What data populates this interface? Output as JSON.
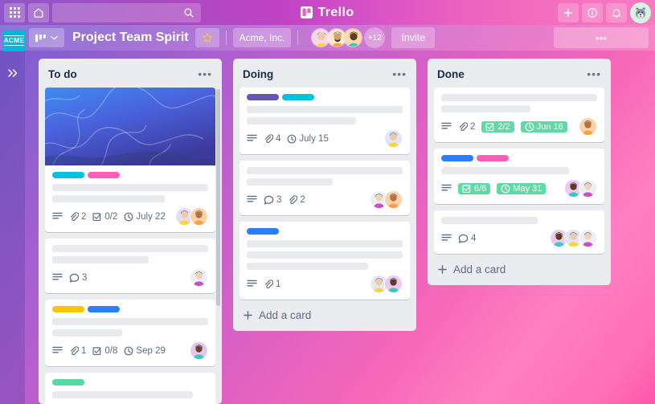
{
  "topbar": {
    "brand": "Trello",
    "brand_logo_icon": "trello-logo-icon",
    "apps_icon": "apps-grid-icon",
    "home_icon": "home-icon",
    "search_icon": "search-icon",
    "search_placeholder": "",
    "search_value": "",
    "add_icon": "plus-icon",
    "info_icon": "info-icon",
    "notifications_icon": "bell-icon",
    "avatar_icon": "user-avatar-dog-icon"
  },
  "board_header": {
    "workspace_logo_text": "ACME",
    "view_switcher_icon": "board-view-icon",
    "view_switcher_caret": "chevron-down-icon",
    "title": "Project Team Spirit",
    "star_icon": "star-icon",
    "workspace_name": "Acme, Inc.",
    "extra_members": "+12",
    "invite_label": "Invite",
    "menu_label": "•••",
    "members": [
      {
        "name": "member-1",
        "skin": "#f0c9a8",
        "hair": "#2e3a59",
        "shirt": "#ffd43b",
        "bg": "#f5d9e6"
      },
      {
        "name": "member-2",
        "skin": "#d8a06a",
        "hair": "#2b2b2b",
        "shirt": "#ff9f43",
        "bg": "#fde8c8"
      },
      {
        "name": "member-3",
        "skin": "#5d3a22",
        "hair": "#1a1a1a",
        "shirt": "#3ec9c0",
        "bg": "#ffd9a8"
      }
    ]
  },
  "sidebar": {
    "expand_icon": "double-chevron-right-icon"
  },
  "lists": [
    {
      "title": "To do",
      "menu_icon": "list-menu-dots-icon",
      "add_card_label": "",
      "has_add_card": false,
      "cards": [
        {
          "has_cover": true,
          "labels": [
            "#00c2e0",
            "#ff5eb8"
          ],
          "lines": [
            100,
            72
          ],
          "badges": [
            {
              "type": "description",
              "icon": "description-icon"
            },
            {
              "type": "attachment",
              "icon": "attachment-icon",
              "text": "2"
            },
            {
              "type": "checklist",
              "icon": "checklist-icon",
              "text": "0/2"
            },
            {
              "type": "due",
              "icon": "clock-icon",
              "text": "July 22"
            }
          ],
          "avatars": [
            {
              "name": "avatar-a",
              "skin": "#f0c9a8",
              "hair": "#2e3a59",
              "shirt": "#ffd43b",
              "bg": "#e7dcf5"
            },
            {
              "name": "avatar-b",
              "skin": "#b5713f",
              "hair": "#1a1a1a",
              "shirt": "#ff9f43",
              "bg": "#ffd2a8"
            }
          ]
        },
        {
          "has_cover": false,
          "labels": [],
          "lines": [
            100,
            62
          ],
          "badges": [
            {
              "type": "description",
              "icon": "description-icon"
            },
            {
              "type": "comment",
              "icon": "comment-icon",
              "text": "3"
            }
          ],
          "avatars": [
            {
              "name": "avatar-c",
              "skin": "#f2d2bd",
              "hair": "#232c4a",
              "shirt": "#cc4fc4",
              "bg": "#eceff4"
            }
          ]
        },
        {
          "has_cover": false,
          "labels": [
            "#ffc400",
            "#2a7fff"
          ],
          "lines": [
            100,
            45
          ],
          "badges": [
            {
              "type": "description",
              "icon": "description-icon"
            },
            {
              "type": "attachment",
              "icon": "attachment-icon",
              "text": "1"
            },
            {
              "type": "checklist",
              "icon": "checklist-icon",
              "text": "0/8"
            },
            {
              "type": "due",
              "icon": "clock-icon",
              "text": "Sep 29"
            }
          ],
          "avatars": [
            {
              "name": "avatar-d",
              "skin": "#6b4226",
              "hair": "#181818",
              "shirt": "#3ec9c0",
              "bg": "#e6c6ee"
            }
          ]
        },
        {
          "has_cover": false,
          "labels": [
            "#57d9a3"
          ],
          "lines": [
            90
          ],
          "badges": [],
          "avatars": []
        }
      ]
    },
    {
      "title": "Doing",
      "menu_icon": "list-menu-dots-icon",
      "add_card_label": "Add a card",
      "has_add_card": true,
      "cards": [
        {
          "has_cover": false,
          "labels": [
            "#6555b5",
            "#00c2e0"
          ],
          "lines": [
            100,
            70
          ],
          "badges": [
            {
              "type": "description",
              "icon": "description-icon"
            },
            {
              "type": "attachment",
              "icon": "attachment-icon",
              "text": "4"
            },
            {
              "type": "due",
              "icon": "clock-icon",
              "text": "July 15"
            }
          ],
          "avatars": [
            {
              "name": "avatar-e",
              "skin": "#f0c9a8",
              "hair": "#2e3a59",
              "shirt": "#ffd43b",
              "bg": "#dfe6f5"
            }
          ]
        },
        {
          "has_cover": false,
          "labels": [],
          "lines": [
            100,
            55
          ],
          "badges": [
            {
              "type": "description",
              "icon": "description-icon"
            },
            {
              "type": "comment",
              "icon": "comment-icon",
              "text": "3"
            },
            {
              "type": "attachment",
              "icon": "attachment-icon",
              "text": "2"
            }
          ],
          "avatars": [
            {
              "name": "avatar-f",
              "skin": "#f2d2bd",
              "hair": "#232c4a",
              "shirt": "#cc4fc4",
              "bg": "#eceff4"
            },
            {
              "name": "avatar-g",
              "skin": "#b5713f",
              "hair": "#1a1a1a",
              "shirt": "#ff9f43",
              "bg": "#ffd2a8"
            }
          ]
        },
        {
          "has_cover": false,
          "labels": [
            "#2a7fff"
          ],
          "lines": [
            100,
            100,
            78
          ],
          "badges": [
            {
              "type": "description",
              "icon": "description-icon"
            },
            {
              "type": "attachment",
              "icon": "attachment-icon",
              "text": "1"
            }
          ],
          "avatars": [
            {
              "name": "avatar-h",
              "skin": "#f0c9a8",
              "hair": "#2e3a59",
              "shirt": "#ffd43b",
              "bg": "#e4e9f7"
            },
            {
              "name": "avatar-i",
              "skin": "#5d3a22",
              "hair": "#161616",
              "shirt": "#3ec9c0",
              "bg": "#edc9ef"
            }
          ]
        }
      ]
    },
    {
      "title": "Done",
      "menu_icon": "list-menu-dots-icon",
      "add_card_label": "Add a card",
      "has_add_card": true,
      "cards": [
        {
          "has_cover": false,
          "labels": [],
          "lines": [
            100,
            57
          ],
          "badges": [
            {
              "type": "description",
              "icon": "description-icon"
            },
            {
              "type": "attachment",
              "icon": "attachment-icon",
              "text": "2"
            },
            {
              "type": "checklist-done",
              "icon": "checklist-icon",
              "text": "2/2"
            },
            {
              "type": "due-done",
              "icon": "clock-icon",
              "text": "Jun 16"
            }
          ],
          "avatars": [
            {
              "name": "avatar-j",
              "skin": "#b5713f",
              "hair": "#1a1a1a",
              "shirt": "#ff9f43",
              "bg": "#ffd2a8"
            }
          ]
        },
        {
          "has_cover": false,
          "labels": [
            "#2a7fff",
            "#ff5eb8"
          ],
          "lines": [
            82
          ],
          "badges": [
            {
              "type": "description",
              "icon": "description-icon"
            },
            {
              "type": "checklist-done",
              "icon": "checklist-icon",
              "text": "6/6"
            },
            {
              "type": "due-done",
              "icon": "clock-icon",
              "text": "May 31"
            }
          ],
          "avatars": [
            {
              "name": "avatar-k",
              "skin": "#5d3a22",
              "hair": "#161616",
              "shirt": "#3ec9c0",
              "bg": "#edc9ef"
            },
            {
              "name": "avatar-l",
              "skin": "#f2d2bd",
              "hair": "#232c4a",
              "shirt": "#cc4fc4",
              "bg": "#eceff4"
            }
          ]
        },
        {
          "has_cover": false,
          "labels": [],
          "lines": [
            62
          ],
          "badges": [
            {
              "type": "description",
              "icon": "description-icon"
            },
            {
              "type": "comment",
              "icon": "comment-icon",
              "text": "4"
            }
          ],
          "avatars": [
            {
              "name": "avatar-m",
              "skin": "#5d3a22",
              "hair": "#161616",
              "shirt": "#3ec9c0",
              "bg": "#edc9ef"
            },
            {
              "name": "avatar-n",
              "skin": "#f0c9a8",
              "hair": "#2e3a59",
              "shirt": "#ffd43b",
              "bg": "#dfe6f5"
            },
            {
              "name": "avatar-o",
              "skin": "#f2d2bd",
              "hair": "#232c4a",
              "shirt": "#cc4fc4",
              "bg": "#eceff4"
            }
          ]
        }
      ]
    }
  ],
  "colors": {
    "label_cyan": "#00c2e0",
    "label_pink": "#ff5eb8",
    "label_purple": "#6555b5",
    "label_blue": "#2a7fff",
    "label_yellow": "#ffc400",
    "label_green": "#57d9a3",
    "badge_done_green": "#61d9a5",
    "list_bg": "#ebecf0",
    "text_dark": "#172b4d",
    "text_muted": "#5e6c84"
  }
}
